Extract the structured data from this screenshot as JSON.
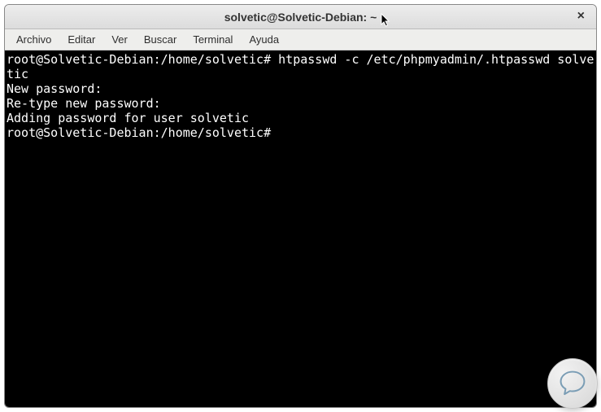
{
  "window": {
    "title": "solvetic@Solvetic-Debian: ~",
    "close_symbol": "×"
  },
  "menubar": {
    "items": [
      "Archivo",
      "Editar",
      "Ver",
      "Buscar",
      "Terminal",
      "Ayuda"
    ]
  },
  "terminal": {
    "lines": [
      "root@Solvetic-Debian:/home/solvetic# htpasswd -c /etc/phpmyadmin/.htpasswd solvetic",
      "New password:",
      "Re-type new password:",
      "Adding password for user solvetic",
      "root@Solvetic-Debian:/home/solvetic# "
    ]
  }
}
